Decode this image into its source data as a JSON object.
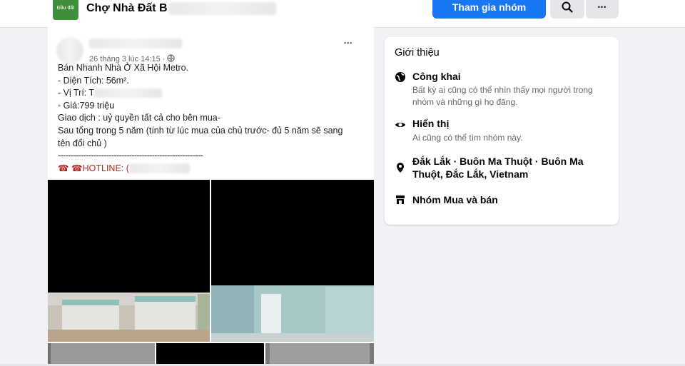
{
  "header": {
    "logo_text": "Đầu đất",
    "group_name": "Chợ Nhà Đất B",
    "join_label": "Tham gia nhóm",
    "search_icon": "search-icon",
    "more_icon": "more-horizontal-icon",
    "more_symbol": "•••"
  },
  "post": {
    "timestamp": "26 tháng 3 lúc 14:15 · ",
    "privacy_icon": "globe-icon",
    "options_symbol": "•••",
    "lines": [
      "Bán Nhanh Nhà Ở Xã Hội Metro.",
      "- Diện Tích: 56m².",
      "- Vị Trí: T",
      "- Giá:799 triệu",
      "Giao dịch : uỷ quyền tất cả cho bên mua-",
      "Sau tổng trong 5 năm (tính từ lúc mua của chủ trước- đủ 5 năm sẽ sang tên đổi chủ )",
      "---------------------------------------------------------",
      "☎ ☎HOTLINE: ("
    ]
  },
  "about": {
    "title": "Giới thiệu",
    "items": [
      {
        "icon": "globe-icon",
        "label": "Công khai",
        "desc": "Bất kỳ ai cũng có thể nhìn thấy mọi người trong nhóm và những gì họ đăng."
      },
      {
        "icon": "eye-icon",
        "label": "Hiển thị",
        "desc": "Ai cũng có thể tìm nhóm này."
      },
      {
        "icon": "location-pin-icon",
        "label": "Đắk Lắk · Buôn Ma Thuột · Buôn Ma Thuột, Đắc Lắk, Vietnam",
        "desc": ""
      },
      {
        "icon": "shop-icon",
        "label": "Nhóm Mua và bán",
        "desc": ""
      }
    ]
  }
}
